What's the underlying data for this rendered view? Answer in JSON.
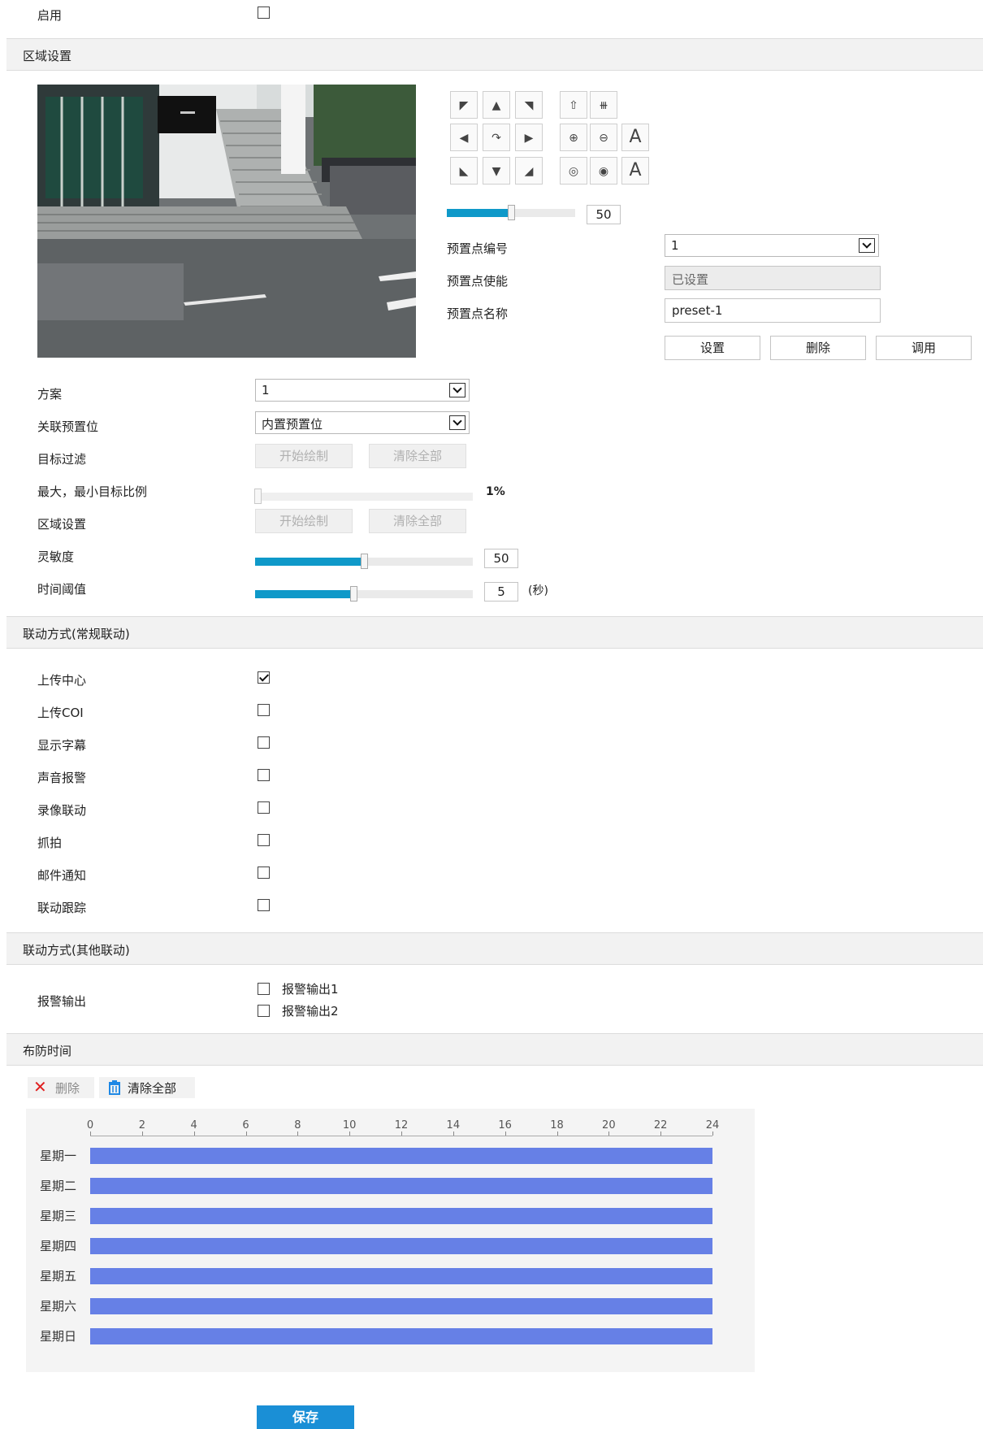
{
  "enable": {
    "label": "启用",
    "checked": false
  },
  "region_section": {
    "title": "区域设置"
  },
  "ptz": {
    "speed_value": "50",
    "speed_fraction": 0.5,
    "icons": [
      "arrow-up-left-icon",
      "arrow-up-icon",
      "arrow-up-right-icon",
      "wiper-icon",
      "light-icon",
      "arrow-left-icon",
      "auto-scan-icon",
      "arrow-right-icon",
      "zoom-in-icon",
      "zoom-out-icon",
      "focus-auto-icon",
      "arrow-down-left-icon",
      "arrow-down-icon",
      "arrow-down-right-icon",
      "iris-open-icon",
      "iris-close-icon",
      "focus-a-icon"
    ],
    "text_glyph_a": "A"
  },
  "preset": {
    "number_label": "预置点编号",
    "number_value": "1",
    "enable_label": "预置点使能",
    "enable_value": "已设置",
    "name_label": "预置点名称",
    "name_value": "preset-1",
    "set_button": "设置",
    "delete_button": "删除",
    "call_button": "调用"
  },
  "form": {
    "scheme_label": "方案",
    "scheme_value": "1",
    "linked_preset_label": "关联预置位",
    "linked_preset_value": "内置预置位",
    "target_filter_label": "目标过滤",
    "start_draw": "开始绘制",
    "clear_all": "清除全部",
    "ratio_label": "最大，最小目标比例",
    "ratio_value": "1%",
    "ratio_fraction": 0.01,
    "area_label": "区域设置",
    "sensitivity_label": "灵敏度",
    "sensitivity_value": "50",
    "sensitivity_fraction": 0.5,
    "time_threshold_label": "时间阈值",
    "time_threshold_value": "5",
    "time_threshold_fraction": 0.45,
    "time_unit": "(秒)"
  },
  "linkage_normal": {
    "title": "联动方式(常规联动)",
    "items": [
      {
        "label": "上传中心",
        "checked": true
      },
      {
        "label": "上传COI",
        "checked": false
      },
      {
        "label": "显示字幕",
        "checked": false
      },
      {
        "label": "声音报警",
        "checked": false
      },
      {
        "label": "录像联动",
        "checked": false
      },
      {
        "label": "抓拍",
        "checked": false
      },
      {
        "label": "邮件通知",
        "checked": false
      },
      {
        "label": "联动跟踪",
        "checked": false
      }
    ]
  },
  "linkage_other": {
    "title": "联动方式(其他联动)",
    "alarm_output_label": "报警输出",
    "outputs": [
      {
        "label": "报警输出1",
        "checked": false
      },
      {
        "label": "报警输出2",
        "checked": false
      }
    ]
  },
  "schedule": {
    "title": "布防时间",
    "delete_label": "删除",
    "clear_all_label": "清除全部",
    "ticks": [
      "0",
      "2",
      "4",
      "6",
      "8",
      "10",
      "12",
      "14",
      "16",
      "18",
      "20",
      "22",
      "24"
    ],
    "days": [
      {
        "name": "星期一",
        "start": 0,
        "end": 24
      },
      {
        "name": "星期二",
        "start": 0,
        "end": 24
      },
      {
        "name": "星期三",
        "start": 0,
        "end": 24
      },
      {
        "name": "星期四",
        "start": 0,
        "end": 24
      },
      {
        "name": "星期五",
        "start": 0,
        "end": 24
      },
      {
        "name": "星期六",
        "start": 0,
        "end": 24
      },
      {
        "name": "星期日",
        "start": 0,
        "end": 24
      }
    ]
  },
  "save_button": "保存",
  "colors": {
    "accent": "#0f99c9",
    "schedule_bar": "#6680e6",
    "delete_red": "#e02020",
    "trash_blue": "#1e88e5"
  }
}
